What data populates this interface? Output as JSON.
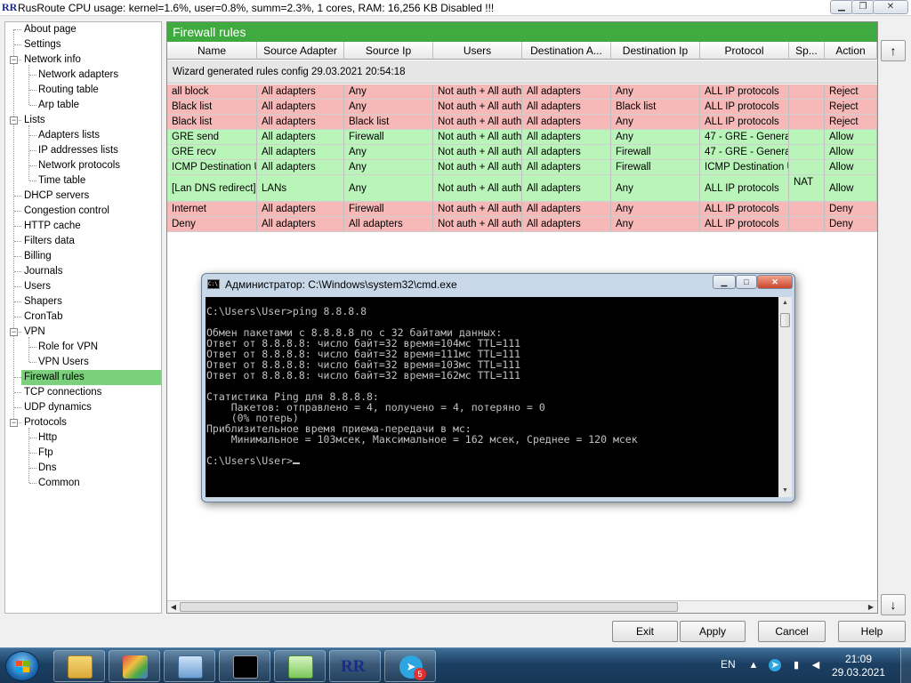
{
  "app": {
    "logo": "RR",
    "title": "RusRoute   CPU usage: kernel=1.6%, user=0.8%, summ=2.3%, 1 cores,   RAM: 16,256 KB Disabled !!!",
    "minimize": "▁",
    "maximize": "❐",
    "close": "✕"
  },
  "tree": {
    "items": [
      {
        "label": "About page"
      },
      {
        "label": "Settings"
      },
      {
        "label": "Network info",
        "toggle": "−"
      },
      {
        "label": "Network adapters"
      },
      {
        "label": "Routing table"
      },
      {
        "label": "Arp table"
      },
      {
        "label": "Lists",
        "toggle": "−"
      },
      {
        "label": "Adapters lists"
      },
      {
        "label": "IP addresses lists"
      },
      {
        "label": "Network protocols"
      },
      {
        "label": "Time table"
      },
      {
        "label": "DHCP servers"
      },
      {
        "label": "Congestion control"
      },
      {
        "label": "HTTP cache"
      },
      {
        "label": "Filters data"
      },
      {
        "label": "Billing"
      },
      {
        "label": "Journals"
      },
      {
        "label": "Users"
      },
      {
        "label": "Shapers"
      },
      {
        "label": "CronTab"
      },
      {
        "label": "VPN",
        "toggle": "−"
      },
      {
        "label": "Role for VPN"
      },
      {
        "label": "VPN Users"
      },
      {
        "label": "Firewall rules"
      },
      {
        "label": "TCP connections"
      },
      {
        "label": "UDP dynamics"
      },
      {
        "label": "Protocols",
        "toggle": "−"
      },
      {
        "label": "Http"
      },
      {
        "label": "Ftp"
      },
      {
        "label": "Dns"
      },
      {
        "label": "Common"
      }
    ]
  },
  "panel": {
    "title": "Firewall rules",
    "columns": [
      "Name",
      "Source Adapter",
      "Source Ip",
      "Users",
      "Destination A...",
      "Destination Ip",
      "Protocol",
      "Sp...",
      "Action"
    ],
    "wizard_text": "Wizard generated rules config 29.03.2021 20:54:18",
    "rows": [
      {
        "status": "red",
        "cells": [
          "all block",
          "All adapters",
          "Any",
          "Not auth + All auth",
          "All adapters",
          "Any",
          "ALL IP protocols",
          "",
          "Reject"
        ]
      },
      {
        "status": "red",
        "cells": [
          "Black list",
          "All adapters",
          "Any",
          "Not auth + All auth",
          "All adapters",
          "Black list",
          "ALL IP protocols",
          "",
          "Reject"
        ]
      },
      {
        "status": "red",
        "cells": [
          "Black list",
          "All adapters",
          "Black list",
          "Not auth + All auth",
          "All adapters",
          "Any",
          "ALL IP protocols",
          "",
          "Reject"
        ]
      },
      {
        "status": "green",
        "cells": [
          "GRE send",
          "All adapters",
          "Firewall",
          "Not auth + All auth",
          "All adapters",
          "Any",
          "47 - GRE - General",
          "",
          "Allow"
        ]
      },
      {
        "status": "green",
        "cells": [
          "GRE recv",
          "All adapters",
          "Any",
          "Not auth + All auth",
          "All adapters",
          "Firewall",
          "47 - GRE - General",
          "",
          "Allow"
        ]
      },
      {
        "status": "green",
        "cells": [
          "ICMP Destination U",
          "All adapters",
          "Any",
          "Not auth + All auth",
          "All adapters",
          "Firewall",
          "ICMP Destination U",
          "",
          "Allow"
        ]
      },
      {
        "status": "green",
        "tall": true,
        "cells": [
          "[Lan DNS redirect]",
          "LANs",
          "Any",
          "Not auth + All auth",
          "All adapters",
          "Any",
          "ALL IP protocols",
          "NAT",
          "Allow"
        ]
      },
      {
        "status": "red",
        "cells": [
          "Internet",
          "All adapters",
          "Firewall",
          "Not auth + All auth",
          "All adapters",
          "Any",
          "ALL IP protocols",
          "",
          "Deny"
        ]
      },
      {
        "status": "red",
        "cells": [
          "Deny",
          "All adapters",
          "All adapters",
          "Not auth + All auth",
          "All adapters",
          "Any",
          "ALL IP protocols",
          "",
          "Deny"
        ]
      }
    ]
  },
  "side_buttons": {
    "up": "↑",
    "down": "↓"
  },
  "buttons": {
    "exit": "Exit",
    "apply": "Apply",
    "cancel": "Cancel",
    "help": "Help"
  },
  "cmd": {
    "title": "Администратор: C:\\Windows\\system32\\cmd.exe",
    "icon_text": "C:\\",
    "minimize": "▁",
    "maximize": "□",
    "close": "✕",
    "lines": [
      "C:\\Users\\User>ping 8.8.8.8",
      "",
      "Обмен пакетами с 8.8.8.8 по с 32 байтами данных:",
      "Ответ от 8.8.8.8: число байт=32 время=104мс TTL=111",
      "Ответ от 8.8.8.8: число байт=32 время=111мс TTL=111",
      "Ответ от 8.8.8.8: число байт=32 время=103мс TTL=111",
      "Ответ от 8.8.8.8: число байт=32 время=162мс TTL=111",
      "",
      "Статистика Ping для 8.8.8.8:",
      "    Пакетов: отправлено = 4, получено = 4, потеряно = 0",
      "    (0% потерь)",
      "Приблизительное время приема-передачи в мс:",
      "    Минимальное = 103мсек, Максимальное = 162 мсек, Среднее = 120 мсек",
      "",
      "C:\\Users\\User>"
    ]
  },
  "taskbar": {
    "rr_label": "RR",
    "telegram_badge": "5",
    "lang": "EN",
    "time": "21:09",
    "date": "29.03.2021"
  }
}
